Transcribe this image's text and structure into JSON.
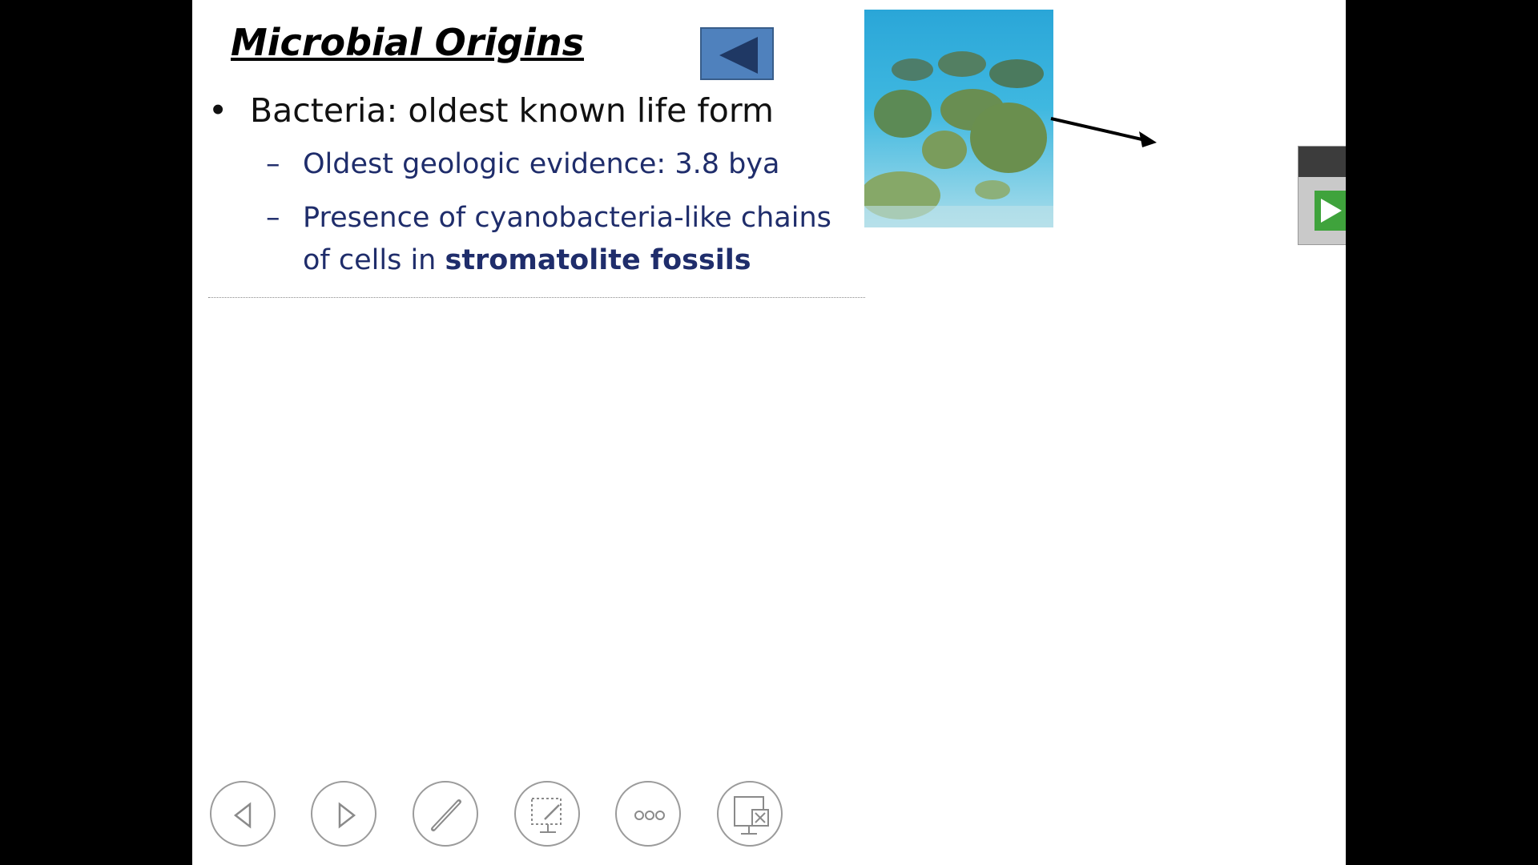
{
  "slide": {
    "title": "Microbial Origins",
    "bullet": "Bacteria:  oldest known life form",
    "sub_bullets": [
      "Oldest geologic evidence:  3.8  bya",
      "Presence of cyanobacteria-like chains",
      "of cells in ",
      "stromatolite fossils"
    ],
    "bullet_symbol": "•",
    "dash_symbol": "–"
  },
  "icons": {
    "back": "back-triangle-icon",
    "toolbar": [
      "previous-icon",
      "next-icon",
      "pen-icon",
      "pointer-options-icon",
      "more-icon",
      "end-show-icon"
    ]
  },
  "colors": {
    "accent_button": "#4f81bd",
    "sub_text": "#1f2d6b",
    "play_green": "#3fa33c"
  }
}
